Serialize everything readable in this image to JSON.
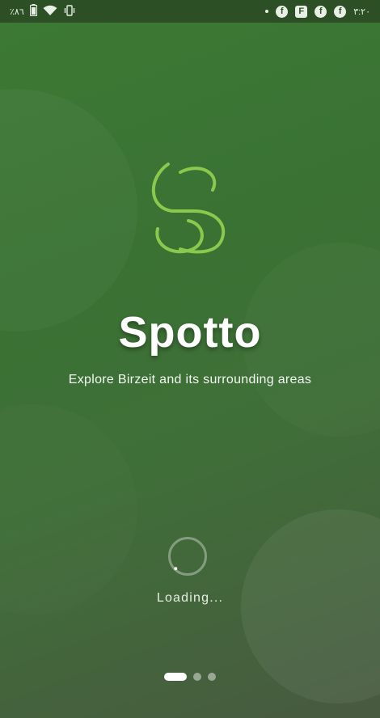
{
  "status_bar": {
    "battery_percent": "٪٨٦",
    "time": "٣:٢٠",
    "icons_left": [
      "battery-icon",
      "wifi-icon",
      "vibrate-icon"
    ],
    "icons_right": [
      "notification-dot-icon",
      "facebook-icon",
      "flipboard-icon",
      "facebook-icon",
      "facebook-icon"
    ],
    "fb_glyph": "f",
    "flip_glyph": "F"
  },
  "splash": {
    "title": "Spotto",
    "subtitle": "Explore Birzeit and its surrounding areas",
    "loading_text": "Loading..."
  },
  "pager": {
    "pages": 3,
    "current": 1
  },
  "colors": {
    "brand_green": "#8ac94c",
    "background_top": "#3d7a35",
    "background_bottom": "#485a40",
    "status_bar": "#2c4f26"
  }
}
